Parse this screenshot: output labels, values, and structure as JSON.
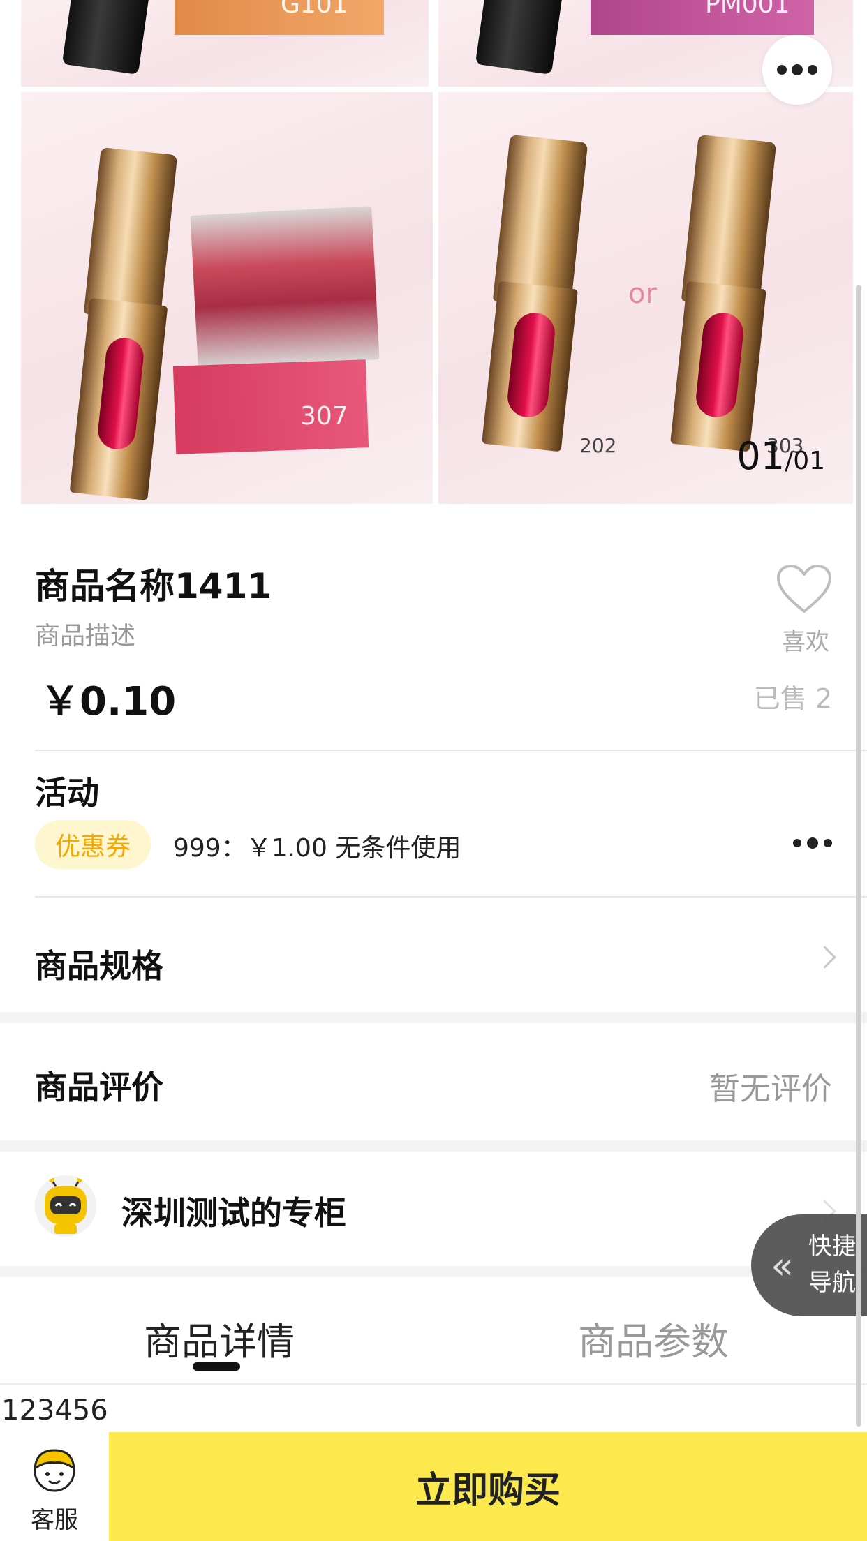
{
  "gallery": {
    "swatch_labels": [
      "G101",
      "PM001",
      "307",
      "or",
      "202",
      "303"
    ],
    "counter_current": "01",
    "counter_total": "/01"
  },
  "product": {
    "title": "商品名称1411",
    "description": "商品描述",
    "price": "￥0.10",
    "like_label": "喜欢",
    "sold": "已售 2"
  },
  "activity": {
    "title": "活动",
    "coupon_badge": "优惠券",
    "coupon_text": "999：￥1.00 无条件使用"
  },
  "spec": {
    "title": "商品规格"
  },
  "review": {
    "title": "商品评价",
    "empty_text": "暂无评价"
  },
  "store": {
    "name": "深圳测试的专柜"
  },
  "quick_nav": {
    "label": "快捷导航"
  },
  "tabs": {
    "details": "商品详情",
    "params": "商品参数"
  },
  "detail_content": "123456",
  "bottom_bar": {
    "service_label": "客服",
    "buy_label": "立即购买"
  },
  "colors": {
    "accent": "#fbe94e",
    "coupon_text": "#f5a800",
    "coupon_bg": "#fdf6cf"
  }
}
